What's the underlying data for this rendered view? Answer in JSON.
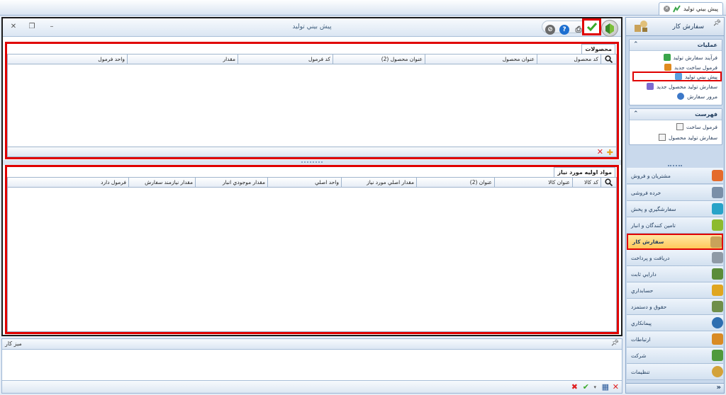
{
  "tab": {
    "label": "پيش بيني توليد"
  },
  "window": {
    "title": "پيش بيني توليد",
    "controls": {
      "close": "✕",
      "restore": "❐",
      "minimize": "–"
    }
  },
  "products_panel": {
    "title": "محصولات",
    "columns": [
      "كد محصول",
      "عنوان محصول",
      "عنوان محصول (2)",
      "كد فرمول",
      "مقدار",
      "واحد فرمول"
    ]
  },
  "materials_panel": {
    "title": "مواد اوليه مورد نياز",
    "columns": [
      "كد كالا",
      "عنوان كالا",
      "عنوان (2)",
      "مقدار اصلي مورد نياز",
      "واحد اصلي",
      "مقدار موجودي انبار",
      "مقدار نيازمند سفارش",
      "فرمول دارد"
    ]
  },
  "workdesk": {
    "title": "ميز كار"
  },
  "nav": {
    "header_title": "سفارش كار",
    "operations": {
      "title": "عمليات",
      "items": [
        {
          "label": "فرآيند سفارش توليد",
          "color": "#3aa54a"
        },
        {
          "label": "فرمول ساخت جديد",
          "color": "#e08a1e"
        },
        {
          "label": "پيش بيني توليد",
          "color": "#5aa0e0"
        },
        {
          "label": "سفارش توليد محصول جديد",
          "color": "#7d6bd0"
        },
        {
          "label": "مرور سفارش",
          "color": "#3c78c8"
        }
      ]
    },
    "list": {
      "title": "فهرست",
      "items": [
        {
          "label": "فرمول ساخت"
        },
        {
          "label": "سفارش توليد محصول"
        }
      ]
    },
    "modules": [
      {
        "label": "مشتريان و فروش",
        "color": "#e46b2c"
      },
      {
        "label": "خرده فروشی",
        "color": "#7a8fa8"
      },
      {
        "label": "سفارشگيري و پخش",
        "color": "#28a3c8"
      },
      {
        "label": "تامين كنندگان و انبار",
        "color": "#8dbb2f"
      },
      {
        "label": "سفارش كار",
        "color": "#c9a25a"
      },
      {
        "label": "دريافت و پرداخت",
        "color": "#8f9aa6"
      },
      {
        "label": "دارايي ثابت",
        "color": "#5a8c3a"
      },
      {
        "label": "حسابداري",
        "color": "#e0a620"
      },
      {
        "label": "حقوق و دستمزد",
        "color": "#6f8f4a"
      },
      {
        "label": "پيمانكاري",
        "color": "#2f6fb0"
      },
      {
        "label": "ارتباطات",
        "color": "#d98b24"
      },
      {
        "label": "شركت",
        "color": "#4f9a3c"
      },
      {
        "label": "تنظيمات",
        "color": "#d3a23a"
      }
    ],
    "active_module_index": 4
  }
}
